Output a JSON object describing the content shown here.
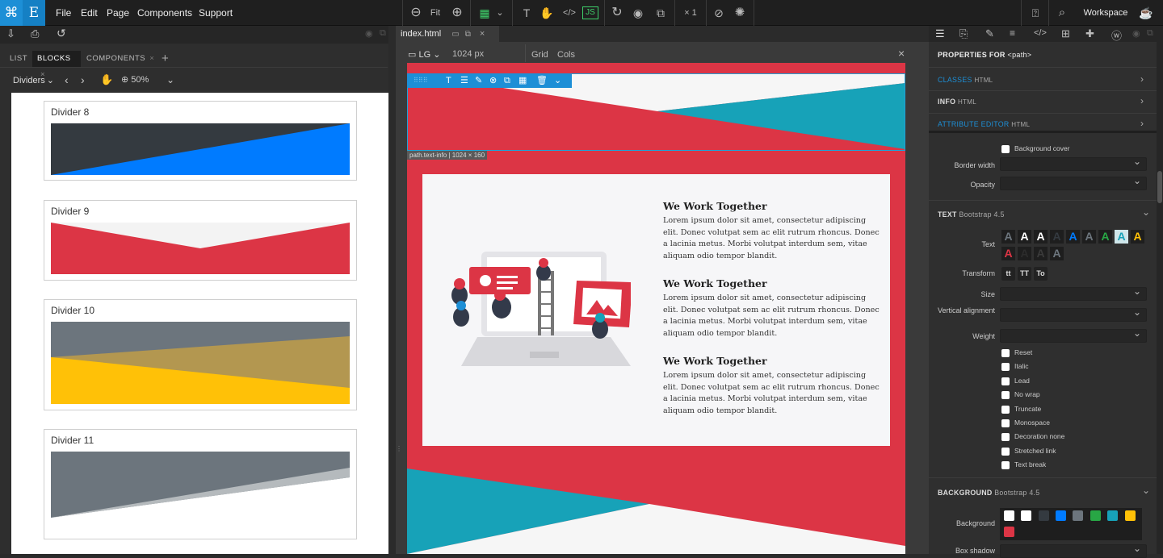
{
  "menu": {
    "file": "File",
    "edit": "Edit",
    "page": "Page",
    "components": "Components",
    "support": "Support"
  },
  "toolbar": {
    "fit": "Fit",
    "zoom_multiplier": "× 1",
    "workspace": "Workspace"
  },
  "left_panel": {
    "tabs": [
      "LIST",
      "BLOCKS",
      "COMPONENTS"
    ],
    "add_tab": "+",
    "category": "Dividers",
    "zoom": "50%",
    "blocks": [
      {
        "title": "Divider 8"
      },
      {
        "title": "Divider 9"
      },
      {
        "title": "Divider 10"
      },
      {
        "title": "Divider 11"
      }
    ]
  },
  "editor": {
    "file_tab": "index.html",
    "breakpoint": "LG",
    "width": "1024 px",
    "grid": "Grid",
    "cols": "Cols",
    "element_info": "path.text-info | 1024 × 160",
    "content": [
      {
        "heading": "We Work Together",
        "body": "Lorem ipsum dolor sit amet, consectetur adipiscing elit. Donec volutpat sem ac elit rutrum rhoncus. Donec a lacinia metus. Morbi volutpat interdum sem, vitae aliquam odio tempor blandit."
      },
      {
        "heading": "We Work Together",
        "body": "Lorem ipsum dolor sit amet, consectetur adipiscing elit. Donec volutpat sem ac elit rutrum rhoncus. Donec a lacinia metus. Morbi volutpat interdum sem, vitae aliquam odio tempor blandit."
      },
      {
        "heading": "We Work Together",
        "body": "Lorem ipsum dolor sit amet, consectetur adipiscing elit. Donec volutpat sem ac elit rutrum rhoncus. Donec a lacinia metus. Morbi volutpat interdum sem, vitae aliquam odio tempor blandit."
      }
    ]
  },
  "properties": {
    "header_prefix": "PROPERTIES FOR",
    "header_target": "<path>",
    "classes": "CLASSES",
    "classes_sub": "HTML",
    "info": "INFO",
    "info_sub": "HTML",
    "attr_editor": "ATTRIBUTE EDITOR",
    "attr_sub": "HTML",
    "background_cover": "Background cover",
    "border_width": "Border width",
    "opacity": "Opacity",
    "text_section": "TEXT",
    "text_section_sub": "Bootstrap 4.5",
    "text_label": "Text",
    "transform_label": "Transform",
    "transform_options": [
      "tt",
      "TT",
      "To"
    ],
    "size_label": "Size",
    "valign_label": "Vertical alignment",
    "weight_label": "Weight",
    "checks": [
      "Reset",
      "Italic",
      "Lead",
      "No wrap",
      "Truncate",
      "Monospace",
      "Decoration none",
      "Stretched link",
      "Text break"
    ],
    "background_section": "BACKGROUND",
    "background_section_sub": "Bootstrap 4.5",
    "background_label": "Background",
    "box_shadow_label": "Box shadow",
    "text_color_letter": "A",
    "colors": {
      "accent": "#1d8fd6",
      "red": "#dc3545",
      "teal": "#17a2b8",
      "yellow": "#ffc107",
      "blue": "#007bff",
      "dark": "#343a40",
      "gray": "#6c757d",
      "green": "#28a745"
    }
  }
}
